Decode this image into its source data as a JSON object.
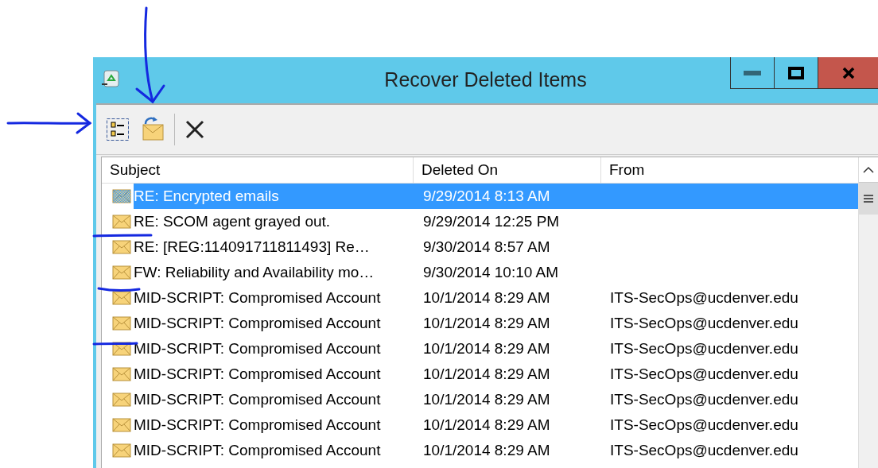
{
  "window": {
    "title": "Recover Deleted Items"
  },
  "table": {
    "columns": [
      "Subject",
      "Deleted On",
      "From"
    ],
    "rows": [
      {
        "subject": "RE: Encrypted emails",
        "deleted_on": "9/29/2014 8:13 AM",
        "selected": true
      },
      {
        "subject": "RE: SCOM agent grayed out.",
        "deleted_on": "9/29/2014 12:25 PM",
        "selected": false
      },
      {
        "subject": "RE: [REG:114091711811493]   Re…",
        "deleted_on": "9/30/2014 8:57 AM",
        "selected": false
      },
      {
        "subject": "FW: Reliability and Availability mo…",
        "deleted_on": "9/30/2014 10:10 AM",
        "selected": false
      },
      {
        "subject": "MID-SCRIPT: Compromised Account",
        "deleted_on": "10/1/2014 8:29 AM",
        "from": "ITS-SecOps@ucdenver.edu",
        "selected": false
      },
      {
        "subject": "MID-SCRIPT: Compromised Account",
        "deleted_on": "10/1/2014 8:29 AM",
        "from": "ITS-SecOps@ucdenver.edu",
        "selected": false
      },
      {
        "subject": "MID-SCRIPT: Compromised Account",
        "deleted_on": "10/1/2014 8:29 AM",
        "from": "ITS-SecOps@ucdenver.edu",
        "selected": false
      },
      {
        "subject": "MID-SCRIPT: Compromised Account",
        "deleted_on": "10/1/2014 8:29 AM",
        "from": "ITS-SecOps@ucdenver.edu",
        "selected": false
      },
      {
        "subject": "MID-SCRIPT: Compromised Account",
        "deleted_on": "10/1/2014 8:29 AM",
        "from": "ITS-SecOps@ucdenver.edu",
        "selected": false
      },
      {
        "subject": "MID-SCRIPT: Compromised Account",
        "deleted_on": "10/1/2014 8:29 AM",
        "from": "ITS-SecOps@ucdenver.edu",
        "selected": false
      },
      {
        "subject": "MID-SCRIPT: Compromised Account",
        "deleted_on": "10/1/2014 8:29 AM",
        "from": "ITS-SecOps@ucdenver.edu",
        "selected": false
      }
    ]
  }
}
